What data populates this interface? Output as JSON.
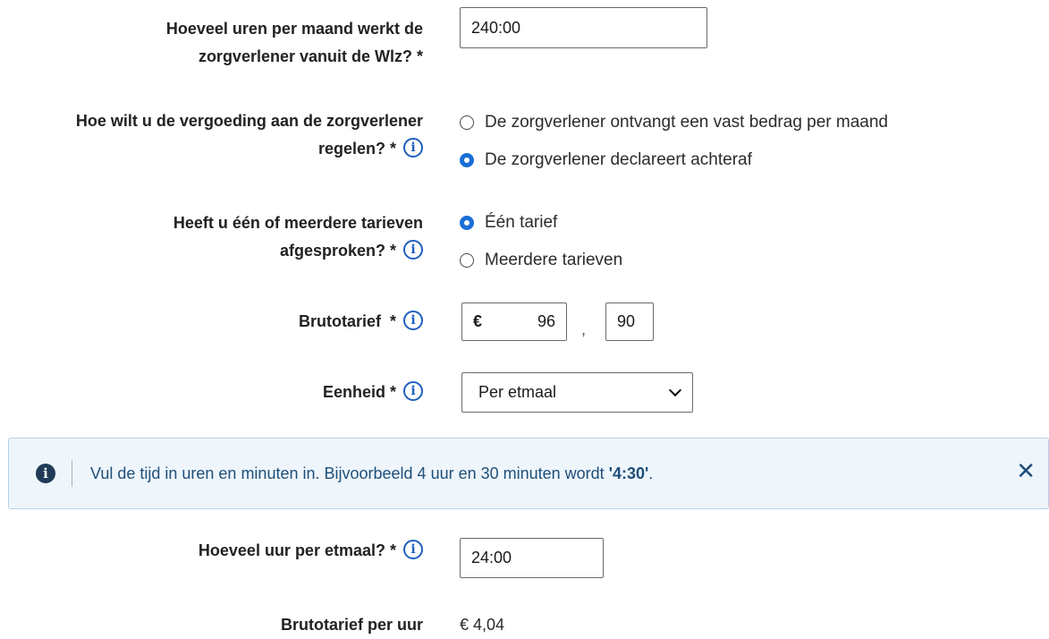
{
  "uren_per_maand": {
    "label_line1": "Hoeveel uren per maand werkt de",
    "label_line2": "zorgverlener vanuit de Wlz? *",
    "value": "240:00"
  },
  "vergoeding": {
    "label_line1": "Hoe wilt u de vergoeding aan de zorgverlener",
    "label_line2": "regelen? *",
    "options": [
      {
        "label": "De zorgverlener ontvangt een vast bedrag per maand",
        "checked": false
      },
      {
        "label": "De zorgverlener declareert achteraf",
        "checked": true
      }
    ]
  },
  "tarieven": {
    "label_line1": "Heeft u één of meerdere tarieven",
    "label_line2": "afgesproken? *",
    "options": [
      {
        "label": "Één tarief",
        "checked": true
      },
      {
        "label": "Meerdere tarieven",
        "checked": false
      }
    ]
  },
  "brutotarief": {
    "label": "Brutotarief  *",
    "currency": "€",
    "euros": "96",
    "separator": ",",
    "cents": "90"
  },
  "eenheid": {
    "label": "Eenheid *",
    "selected": "Per etmaal"
  },
  "alert": {
    "icon": "i",
    "text_before": "Vul de tijd in uren en minuten in. Bijvoorbeeld 4 uur en 30 minuten wordt ",
    "text_bold": "'4:30'",
    "text_after": ".",
    "close": "✕"
  },
  "uur_per_etmaal": {
    "label": "Hoeveel uur per etmaal? *",
    "value": "24:00"
  },
  "brutotarief_per_uur": {
    "label": "Brutotarief per uur",
    "value": "€ 4,04"
  },
  "info_glyph": "i"
}
